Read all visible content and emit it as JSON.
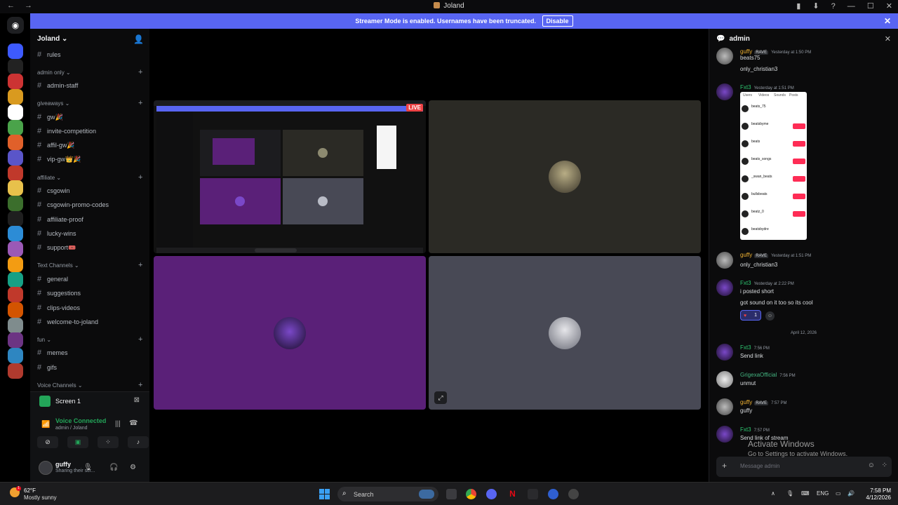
{
  "window": {
    "title": "Joland",
    "controls": [
      "—",
      "☐",
      "✕"
    ]
  },
  "banner": {
    "text": "Streamer Mode is enabled. Usernames have been truncated.",
    "button": "Disable"
  },
  "server": {
    "name": "Joland"
  },
  "channels": [
    {
      "type": "channel",
      "name": "rules"
    },
    {
      "type": "category",
      "name": "admin only"
    },
    {
      "type": "channel",
      "name": "admin-staff"
    },
    {
      "type": "category",
      "name": "giveaways"
    },
    {
      "type": "channel",
      "name": "gw🎉"
    },
    {
      "type": "channel",
      "name": "invite-competition"
    },
    {
      "type": "channel",
      "name": "affil-gw🎉"
    },
    {
      "type": "channel",
      "name": "vip-gw👑🎉"
    },
    {
      "type": "category",
      "name": "affiliate"
    },
    {
      "type": "channel",
      "name": "csgowin"
    },
    {
      "type": "channel",
      "name": "csgowin-promo-codes"
    },
    {
      "type": "channel",
      "name": "affiliate-proof"
    },
    {
      "type": "channel",
      "name": "lucky-wins"
    },
    {
      "type": "channel",
      "name": "support🎟️"
    },
    {
      "type": "category",
      "name": "Text Channels"
    },
    {
      "type": "channel",
      "name": "general"
    },
    {
      "type": "channel",
      "name": "suggestions"
    },
    {
      "type": "channel",
      "name": "clips-videos"
    },
    {
      "type": "channel",
      "name": "welcome-to-joland"
    },
    {
      "type": "category",
      "name": "fun"
    },
    {
      "type": "channel",
      "name": "memes"
    },
    {
      "type": "channel",
      "name": "gifs"
    },
    {
      "type": "category",
      "name": "Voice Channels"
    }
  ],
  "screen": {
    "title": "Screen 1"
  },
  "voice": {
    "status": "Voice Connected",
    "location": "admin / Joland"
  },
  "user": {
    "name": "guffy",
    "status": "Sharing their scr..."
  },
  "stream": {
    "live_label": "LIVE"
  },
  "chat": {
    "channel": "admin",
    "messages": [
      {
        "author": "guffy",
        "tag": "RAVE",
        "time": "Yesterday at 1:50 PM",
        "lines": [
          "beats75",
          "only_christian3"
        ]
      },
      {
        "author": "Fxt3",
        "time": "Yesterday at 1:51 PM",
        "lines": []
      },
      {
        "author": "guffy",
        "tag": "RAVE",
        "time": "Yesterday at 1:51 PM",
        "lines": [
          "only_christian3"
        ]
      },
      {
        "author": "Fxt3",
        "time": "Yesterday at 2:22 PM",
        "lines": [
          "i posted short",
          "got sound on it too so its cool"
        ]
      },
      {
        "author": "Fxt3",
        "time": "7:56 PM",
        "lines": [
          "Send link"
        ]
      },
      {
        "author": "GrigexaOfficial",
        "time": "7:56 PM",
        "lines": [
          "unmut"
        ]
      },
      {
        "author": "guffy",
        "tag": "RAVE",
        "time": "7:57 PM",
        "lines": [
          "guffy"
        ]
      },
      {
        "author": "Fxt3",
        "time": "7:57 PM",
        "lines": [
          "Send link of stream"
        ]
      }
    ],
    "date_separator": "April 12, 2026",
    "reaction_count": "1",
    "placeholder": "Message admin",
    "screenshot_tabs": [
      "Users",
      "Videos",
      "Sounds",
      "Posts"
    ],
    "screenshot_rows": [
      "beats_75",
      "beatsbyme",
      "beats",
      "beats_songs",
      "_swan_beats",
      "bullsbeats",
      "beatz_0",
      "beatsbydre"
    ],
    "screenshot_follow": "Follow"
  },
  "watermark": {
    "line1": "Activate Windows",
    "line2": "Go to Settings to activate Windows."
  },
  "taskbar": {
    "weather_temp": "62°F",
    "weather_cond": "Mostly sunny",
    "weather_badge": "1",
    "search_placeholder": "Search",
    "lang": "ENG",
    "time": "7:58 PM",
    "date": "4/12/2026"
  },
  "colors": {
    "accent": "#5865f2",
    "online": "#23a559",
    "live": "#ed4245",
    "fxt3": "#2dc770",
    "guffy": "#f0b232",
    "grigexa": "#43b581"
  }
}
